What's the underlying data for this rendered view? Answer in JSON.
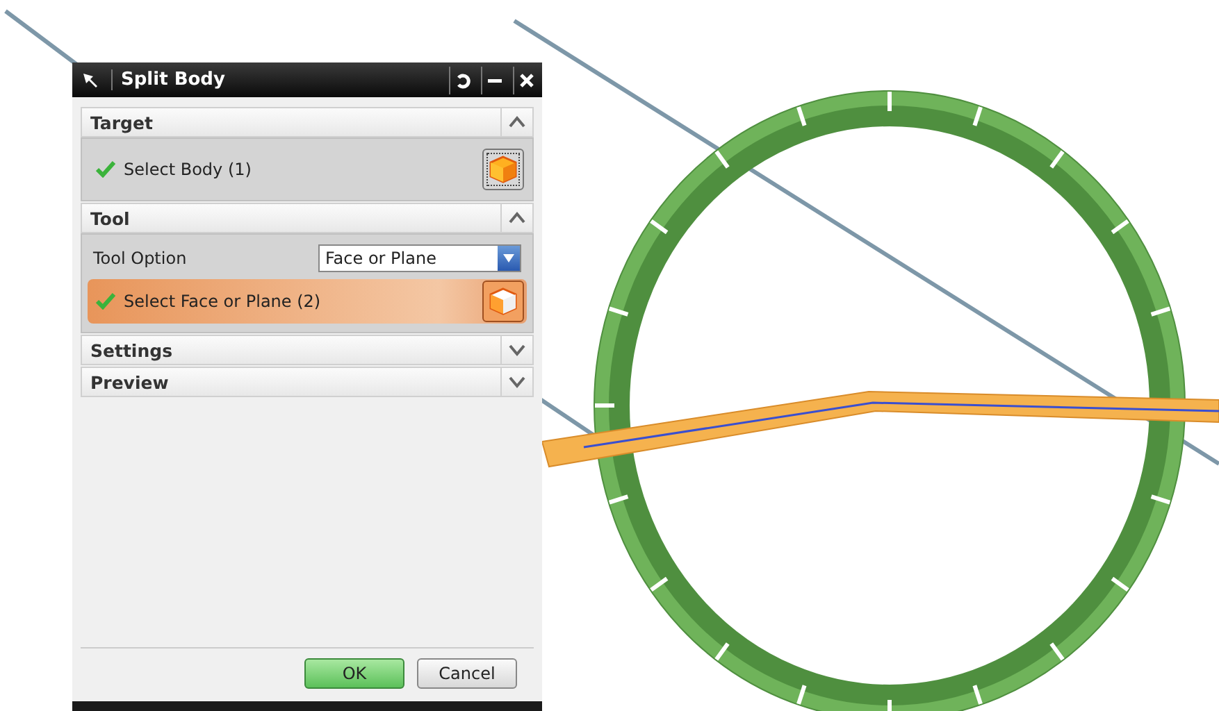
{
  "dialog": {
    "title": "Split Body"
  },
  "sections": [
    {
      "title": "Target",
      "expanded": true,
      "items": [
        {
          "kind": "selection",
          "label": "Select Body (1)",
          "selected": false
        }
      ]
    },
    {
      "title": "Tool",
      "expanded": true,
      "items": [
        {
          "kind": "option",
          "label": "Tool Option",
          "value": "Face or Plane"
        },
        {
          "kind": "selection",
          "label": "Select Face or Plane (2)",
          "selected": true
        }
      ]
    },
    {
      "title": "Settings",
      "expanded": false
    },
    {
      "title": "Preview",
      "expanded": false
    }
  ],
  "buttons": [
    {
      "label": "OK",
      "default": true
    },
    {
      "label": "Cancel",
      "default": false
    }
  ]
}
